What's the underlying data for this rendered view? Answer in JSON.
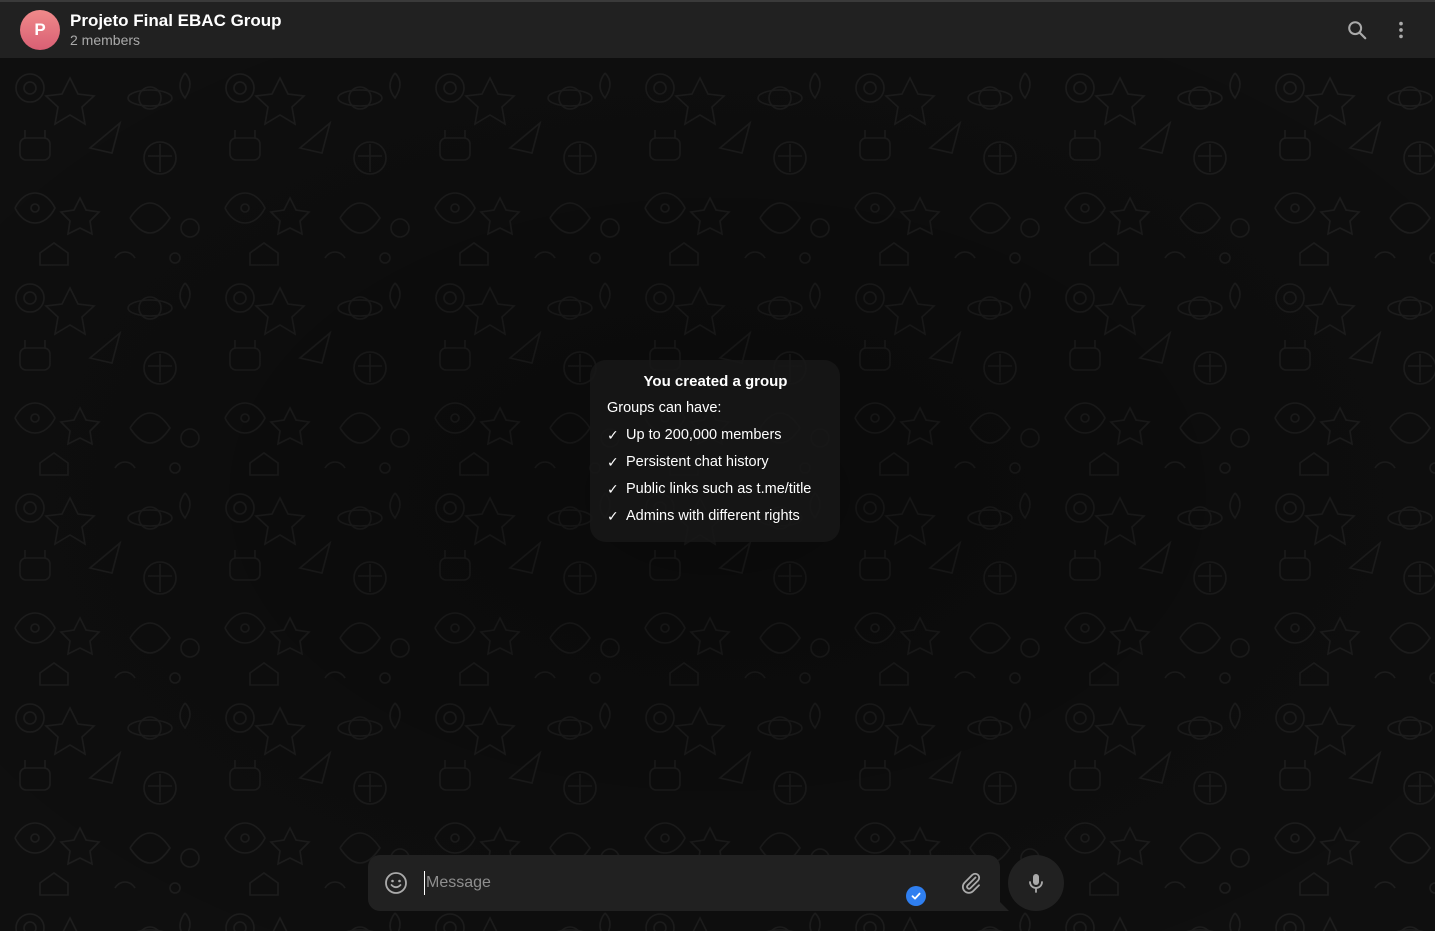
{
  "header": {
    "avatar_letter": "P",
    "title": "Projeto Final EBAC Group",
    "subtitle": "2 members",
    "actions": [
      {
        "name": "search-icon"
      },
      {
        "name": "more-vertical-icon"
      }
    ]
  },
  "service_message": {
    "title": "You created a group",
    "subtitle": "Groups can have:",
    "check_glyph": "✓",
    "features": [
      "Up to 200,000 members",
      "Persistent chat history",
      "Public links such as t.me/title",
      "Admins with different rights"
    ]
  },
  "composer": {
    "placeholder": "Message",
    "value": "",
    "icons": [
      "smile-icon",
      "check-circle-icon",
      "paperclip-icon",
      "microphone-icon"
    ]
  },
  "colors": {
    "header_bg": "#212121",
    "chat_bg": "#0f0f0f",
    "composer_bg": "#212121",
    "avatar_gradient_top": "#f08a8a",
    "avatar_gradient_bottom": "#d95f74",
    "subtitle_text": "#aaaaaa",
    "badge_blue": "#2f7ff0"
  }
}
